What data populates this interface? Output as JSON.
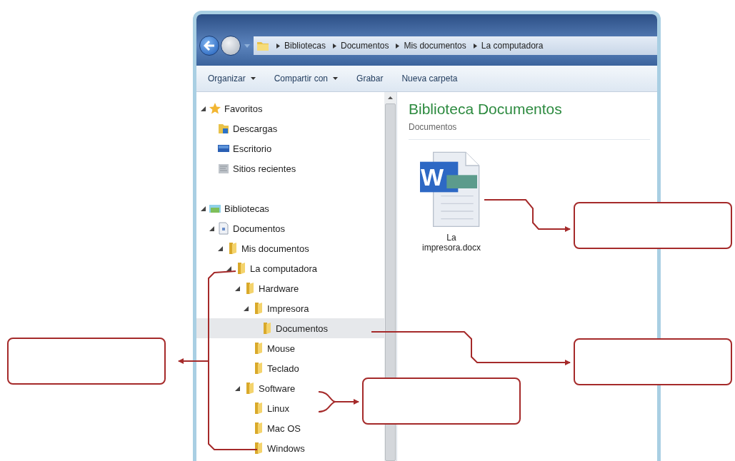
{
  "address_bar": {
    "breadcrumbs": [
      "Bibliotecas",
      "Documentos",
      "Mis documentos",
      "La computadora"
    ]
  },
  "toolbar": [
    {
      "label": "Organizar",
      "has_menu": true
    },
    {
      "label": "Compartir con",
      "has_menu": true
    },
    {
      "label": "Grabar",
      "has_menu": false
    },
    {
      "label": "Nueva carpeta",
      "has_menu": false
    }
  ],
  "navigation_tree": [
    {
      "label": "Favoritos",
      "kind": "star",
      "expanded": true,
      "selected": false,
      "children": [
        {
          "label": "Descargas",
          "kind": "downloads",
          "selected": false
        },
        {
          "label": "Escritorio",
          "kind": "desktop",
          "selected": false
        },
        {
          "label": "Sitios recientes",
          "kind": "recent",
          "selected": false
        }
      ]
    },
    {
      "label": "Bibliotecas",
      "kind": "library",
      "expanded": true,
      "selected": false,
      "children": [
        {
          "label": "Documentos",
          "kind": "doclib",
          "expanded": true,
          "selected": false,
          "children": [
            {
              "label": "Mis documentos",
              "kind": "folder",
              "expanded": true,
              "selected": false,
              "children": [
                {
                  "label": "La computadora",
                  "kind": "folder",
                  "expanded": true,
                  "selected": false,
                  "children": [
                    {
                      "label": "Hardware",
                      "kind": "folder",
                      "expanded": true,
                      "selected": false,
                      "children": [
                        {
                          "label": "Impresora",
                          "kind": "folder",
                          "expanded": true,
                          "selected": false,
                          "children": [
                            {
                              "label": "Documentos",
                              "kind": "folder",
                              "selected": true
                            }
                          ]
                        },
                        {
                          "label": "Mouse",
                          "kind": "folder",
                          "selected": false
                        },
                        {
                          "label": "Teclado",
                          "kind": "folder",
                          "selected": false
                        }
                      ]
                    },
                    {
                      "label": "Software",
                      "kind": "folder",
                      "expanded": true,
                      "selected": false,
                      "children": [
                        {
                          "label": "Linux",
                          "kind": "folder",
                          "selected": false
                        },
                        {
                          "label": "Mac OS",
                          "kind": "folder",
                          "selected": false
                        },
                        {
                          "label": "Windows",
                          "kind": "folder",
                          "selected": false
                        }
                      ]
                    }
                  ]
                }
              ]
            }
          ]
        }
      ]
    }
  ],
  "content": {
    "title": "Biblioteca Documentos",
    "subtitle": "Documentos",
    "files": [
      {
        "name": "La impresora.docx",
        "kind": "word",
        "icon_letter": "W"
      }
    ]
  }
}
